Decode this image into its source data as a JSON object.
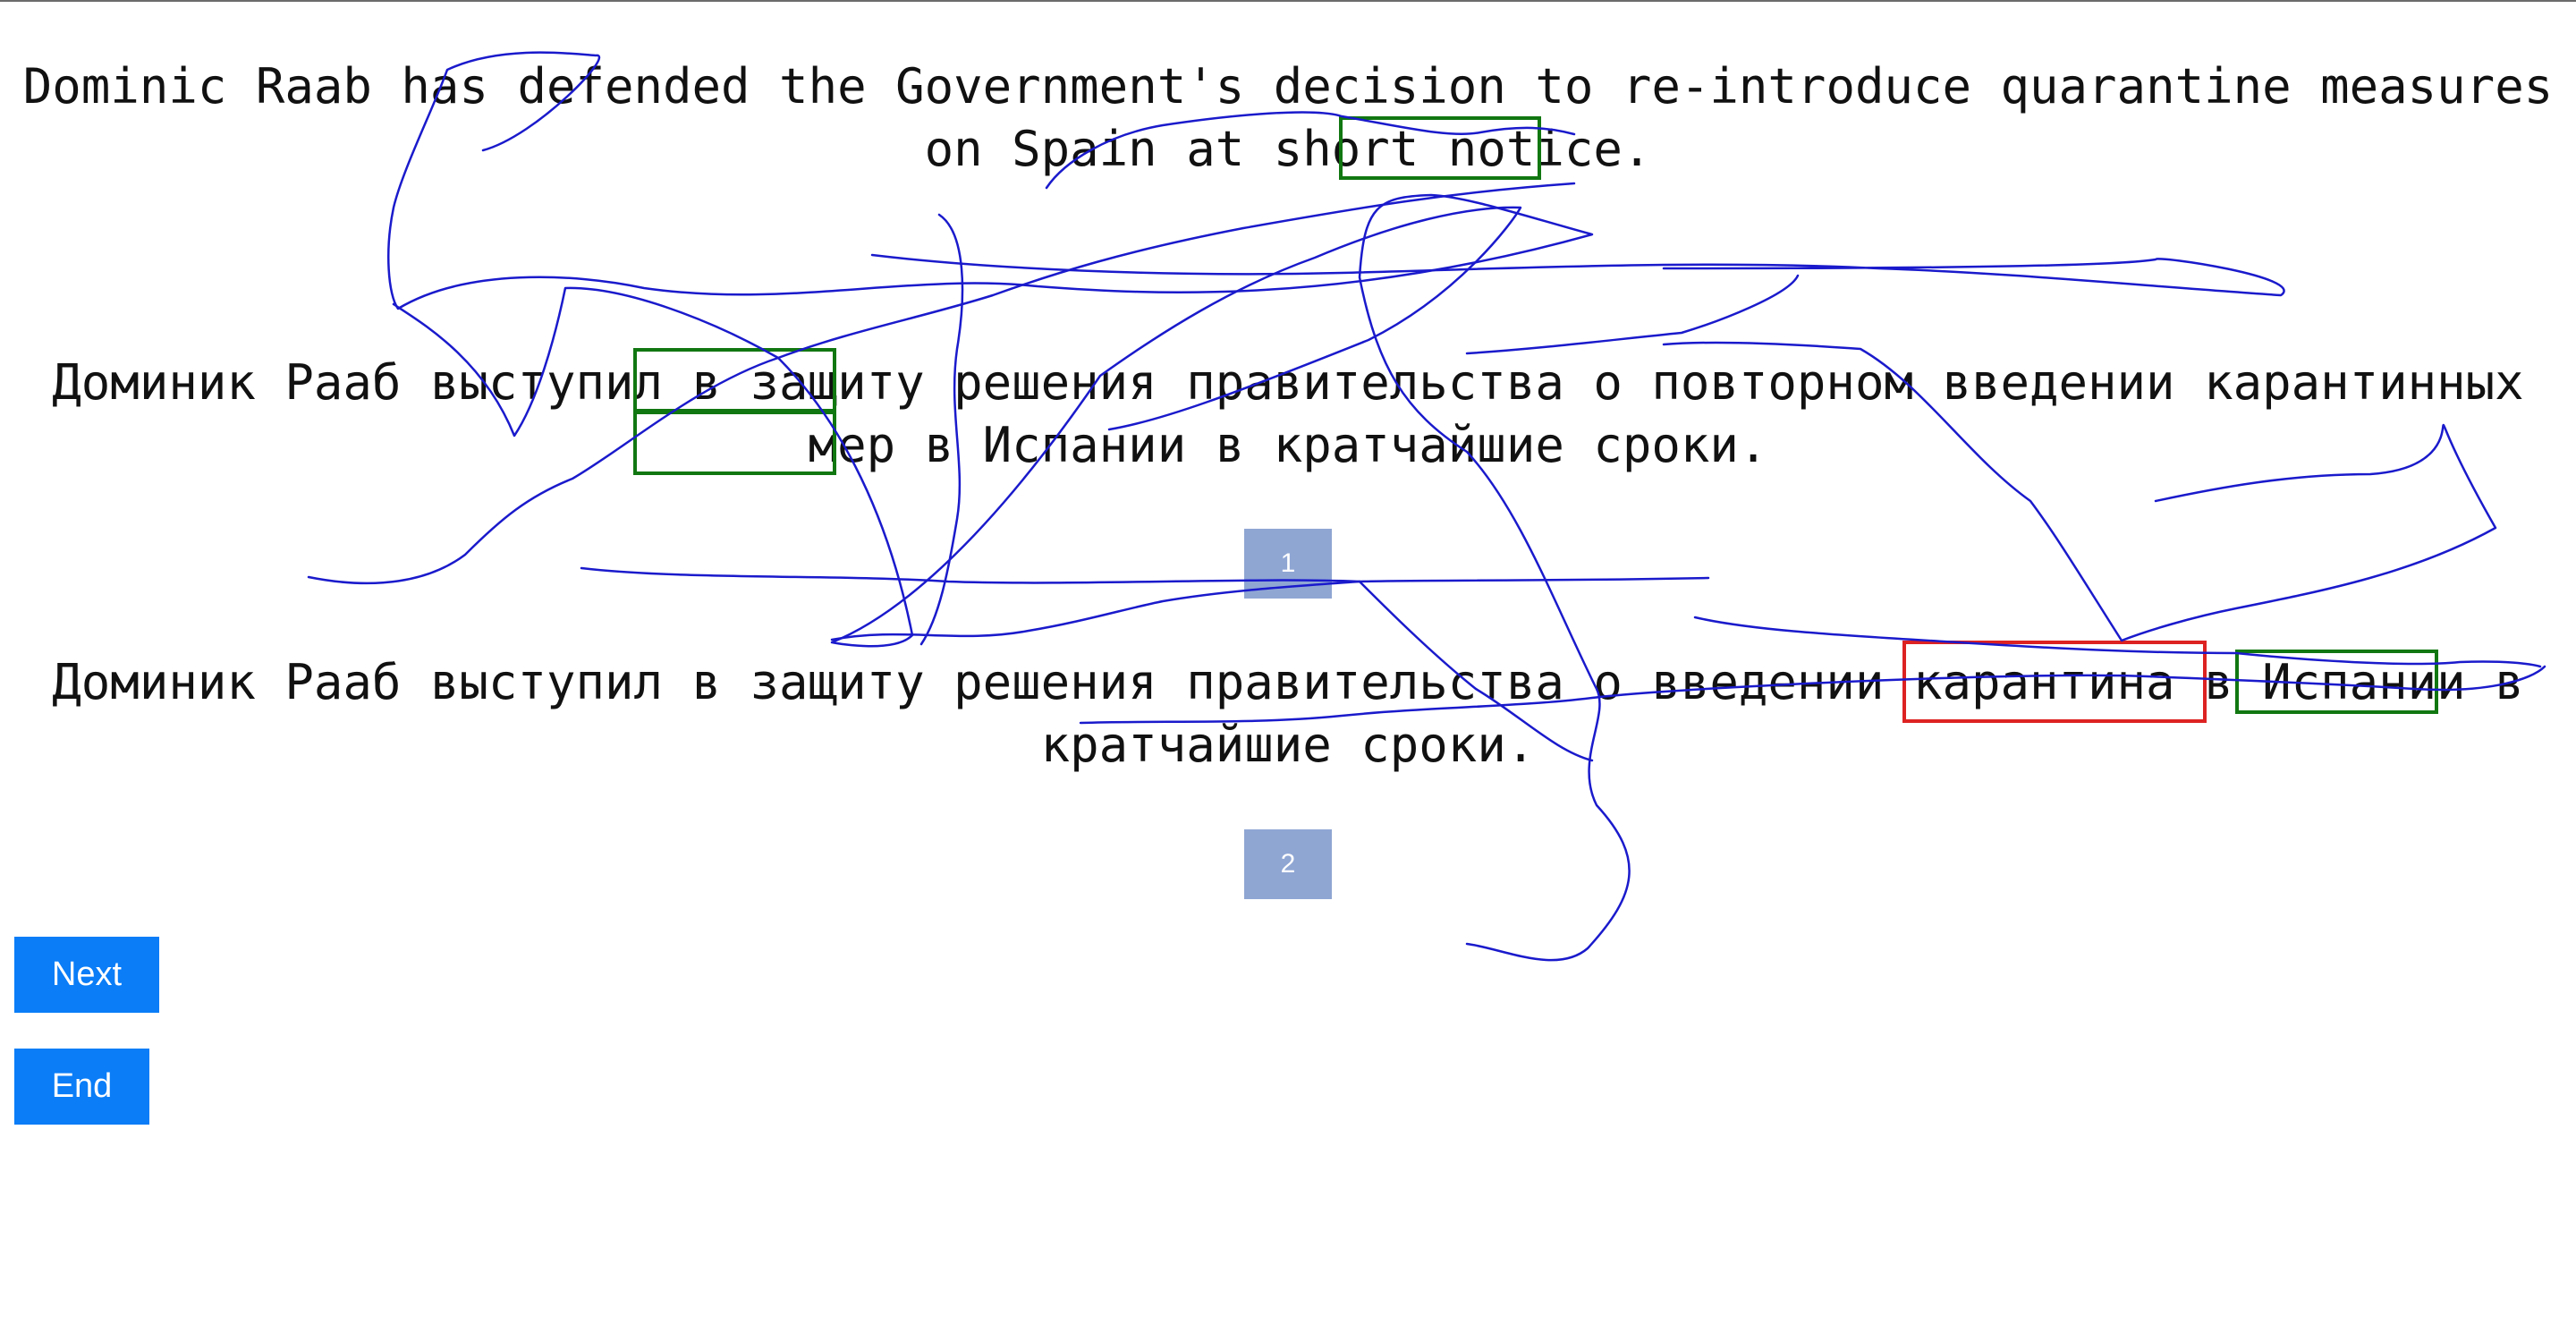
{
  "source_sentence": "Dominic Raab has defended the Government's decision to re-introduce quarantine measures on Spain at short notice.",
  "translations": [
    {
      "text": "Доминик Рааб выступил в защиту решения правительства о повторном введении карантинных мер в Испании в кратчайшие сроки.",
      "rank": "1"
    },
    {
      "text": "Доминик Рааб выступил в защиту решения правительства о введении карантина в Испании в кратчайшие сроки.",
      "rank": "2"
    }
  ],
  "buttons": {
    "next": "Next",
    "end": "End"
  },
  "colors": {
    "highlight_good": "#117711",
    "highlight_bad": "#dd2222",
    "rank_badge": "#8fa6d3",
    "button": "#0a7df7",
    "scribble": "#1a1acc"
  }
}
